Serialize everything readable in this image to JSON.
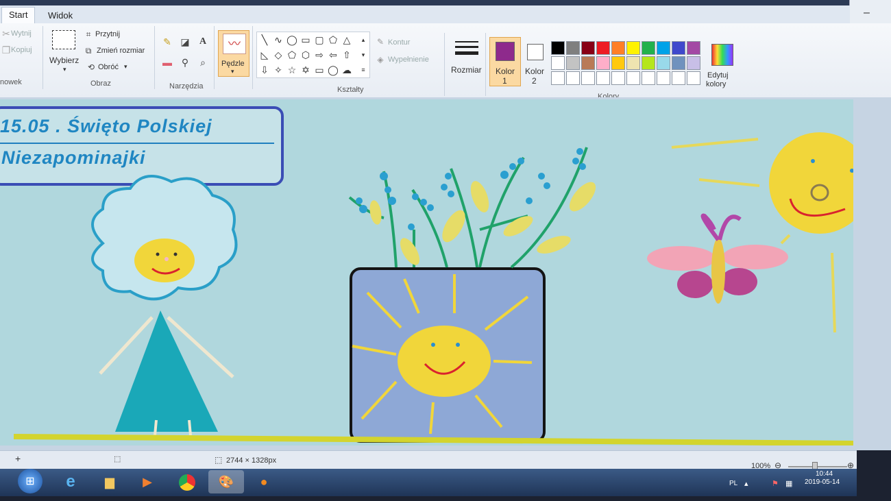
{
  "tabs": {
    "start": "Start",
    "view": "Widok"
  },
  "clipboard": {
    "cut": "Wytnij",
    "copy": "Kopiuj",
    "group_label": "nowek"
  },
  "image": {
    "select": "Wybierz",
    "crop": "Przytnij",
    "resize": "Zmień rozmiar",
    "rotate": "Obróć",
    "group_label": "Obraz"
  },
  "tools": {
    "group_label": "Narzędzia",
    "text_glyph": "A"
  },
  "brushes": {
    "label": "Pędzle"
  },
  "shapes": {
    "group_label": "Kształty",
    "outline": "Kontur",
    "fill": "Wypełnienie"
  },
  "size": {
    "label": "Rozmiar"
  },
  "colors": {
    "color1_label": "Kolor",
    "color1_num": "1",
    "color2_label": "Kolor",
    "color2_num": "2",
    "edit_label_1": "Edytuj",
    "edit_label_2": "kolory",
    "group_label": "Kolory",
    "color1": "#8e2a8c",
    "color2": "#ffffff",
    "palette": [
      "#000000",
      "#7f7f7f",
      "#880015",
      "#ed1c24",
      "#ff7f27",
      "#fff200",
      "#22b14c",
      "#00a2e8",
      "#3f48cc",
      "#a349a4",
      "#ffffff",
      "#c3c3c3",
      "#b97a57",
      "#ffaec9",
      "#ffc90e",
      "#efe4b0",
      "#b5e61d",
      "#99d9ea",
      "#7092be",
      "#c8bfe7"
    ]
  },
  "drawing": {
    "title_line1": "15.05 . Święto Polskiej",
    "title_line2": "Niezapominajki"
  },
  "status": {
    "dimensions": "2744 × 1328px",
    "zoom": "100%"
  },
  "tray": {
    "lang": "PL",
    "time": "10:44",
    "date": "2019-05-14"
  },
  "window": {
    "minimize": "–"
  }
}
